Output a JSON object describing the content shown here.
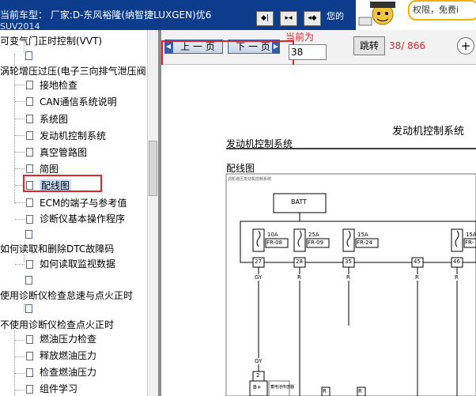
{
  "titlebar": {
    "current_car": "当前车型：  厂家:D-东风裕隆(纳智捷LUXGEN)优6",
    "suv": "SUV2014",
    "welcome": "您的"
  },
  "ad": {
    "text": "权限，免费i"
  },
  "tree": {
    "items": [
      {
        "label": "可变气门正时控制(VVT)"
      },
      {
        "label": ""
      },
      {
        "label": "涡轮增压过压(电子三向排气泄压阀"
      },
      {
        "label": "接地检查"
      },
      {
        "label": "CAN通信系统说明"
      },
      {
        "label": "系统图"
      },
      {
        "label": "发动机控制系统"
      },
      {
        "label": "真空管路图"
      },
      {
        "label": "简图"
      },
      {
        "label": "配线图"
      },
      {
        "label": "ECM的端子与参考值"
      },
      {
        "label": "诊断仪基本操作程序"
      },
      {
        "label": ""
      },
      {
        "label": "如何读取和删除DTC故障码"
      },
      {
        "label": "如何读取监视数据"
      },
      {
        "label": ""
      },
      {
        "label": "使用诊断仪检查怠速与点火正时"
      },
      {
        "label": ""
      },
      {
        "label": "不使用诊断仪检查点火正时"
      },
      {
        "label": "燃油压力检查"
      },
      {
        "label": "释放燃油压力"
      },
      {
        "label": "检查燃油压力"
      },
      {
        "label": "组件学习"
      }
    ]
  },
  "toolbar": {
    "prev_label": "上 一 页",
    "next_label": "下 一 页",
    "current_label": "当前为",
    "current_page": "38",
    "jump_label": "跳转",
    "page_count": "38/ 866",
    "zoom_label": "+"
  },
  "document": {
    "header_right": "发动机控制系统",
    "section_title": "发动机控制系统",
    "subsection": "配线图",
    "diagram_caption": "涡轮增压发动机控制系统",
    "batt": "BATT",
    "fuses": [
      {
        "amp": "10A",
        "code": "FR-08"
      },
      {
        "amp": "25A",
        "code": "FR-09"
      },
      {
        "amp": "15A",
        "code": "FR-24"
      },
      {
        "amp": "15A",
        "code": "FR-"
      }
    ],
    "pins": [
      "27",
      "28",
      "35",
      "45",
      "46"
    ],
    "wires": [
      "GY",
      "R",
      "R",
      "R",
      "R"
    ],
    "low_wire": "GY",
    "connector_pin": "2",
    "bplus": "B+",
    "side_note": "蓄电池传感器",
    "low_pins": [
      "R",
      "R"
    ]
  },
  "colors": {
    "title_bg": "#0d3c8c",
    "red": "#e0242b"
  }
}
